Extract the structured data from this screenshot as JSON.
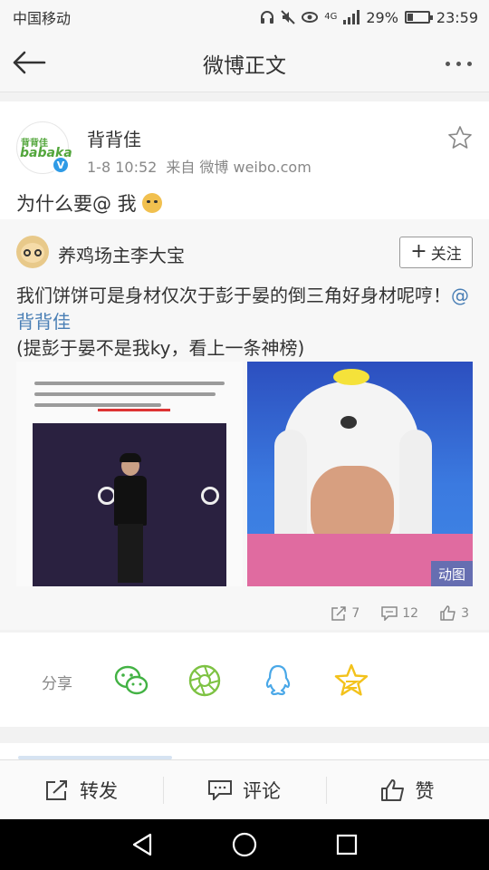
{
  "status_bar": {
    "carrier": "中国移动",
    "network": "4G",
    "battery_percent": "29%",
    "battery_level": 0.29,
    "time": "23:59"
  },
  "nav": {
    "title": "微博正文",
    "back_icon": "arrow-left-icon",
    "more_icon": "more-dots-icon"
  },
  "post": {
    "author": "背背佳",
    "avatar_text_line1": "背背佳",
    "avatar_text_line2": "babaka",
    "verified_mark": "V",
    "date": "1-8 10:52",
    "source": "来自 微博 weibo.com",
    "text": "为什么要@ 我",
    "emoji": "dog-face-emoji"
  },
  "retweet": {
    "author": "养鸡场主李大宝",
    "follow_plus": "+",
    "follow_label": "关注",
    "text_before_mention": "我们饼饼可是身材仅次于彭于晏的倒三角好身材呢哼！",
    "mention": "@背背佳",
    "text_line3": "(提彭于晏不是我ky，看上一条神榜)",
    "gif_badge": "动图",
    "reposts": "7",
    "comments": "12",
    "likes": "3"
  },
  "share": {
    "label": "分享",
    "options": [
      "wechat-icon",
      "moments-icon",
      "qq-icon",
      "qzone-icon"
    ]
  },
  "actions": {
    "repost_label": "转发",
    "comment_label": "评论",
    "like_label": "赞"
  },
  "colors": {
    "link": "#4a7fb5",
    "wechat_green": "#43b244",
    "moments_green": "#7dc242",
    "qq_blue": "#4aa8e8",
    "qzone_yellow": "#f3c21b",
    "verified_blue": "#2f9be6"
  }
}
